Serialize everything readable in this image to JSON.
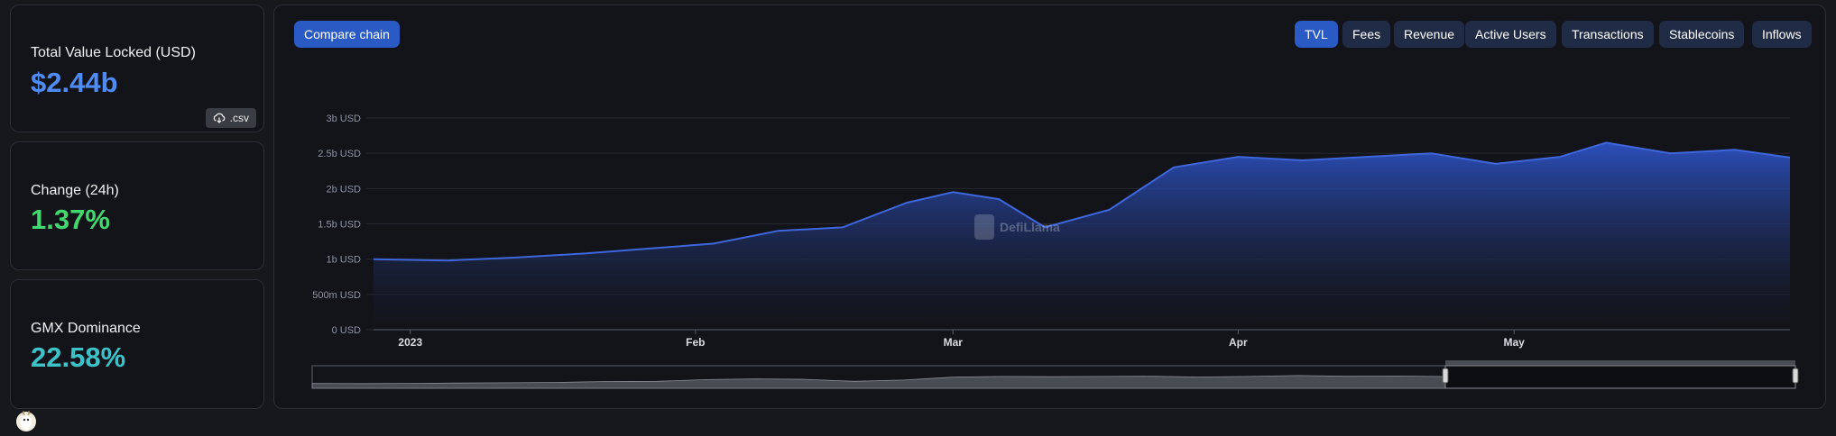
{
  "stats": {
    "tvl": {
      "label": "Total Value Locked (USD)",
      "value": "$2.44b",
      "csv_label": ".csv",
      "color": "#4f8bf4"
    },
    "change": {
      "label": "Change (24h)",
      "value": "1.37%",
      "color": "#42d86f"
    },
    "dominance": {
      "label": "GMX Dominance",
      "value": "22.58%",
      "color": "#3dc2c8"
    }
  },
  "toolbar": {
    "compare_label": "Compare chain",
    "metrics": [
      "TVL",
      "Fees",
      "Revenue",
      "Active Users",
      "Transactions",
      "Stablecoins",
      "Inflows"
    ],
    "active_metric": "TVL"
  },
  "watermark": "DefiLlama",
  "colors": {
    "accent": "#2a5ac3",
    "area_line": "#3f67dd",
    "background": "#131419"
  },
  "chart_data": {
    "type": "area",
    "title": "",
    "xlabel": "",
    "ylabel": "",
    "ylim": [
      0,
      3000000000
    ],
    "y_tick_labels": [
      "0 USD",
      "500m USD",
      "1b USD",
      "1.5b USD",
      "2b USD",
      "2.5b USD",
      "3b USD"
    ],
    "x_tick_labels": [
      "2023",
      "Feb",
      "Mar",
      "Apr",
      "May"
    ],
    "grid": true,
    "series": [
      {
        "values_unit": "USD (billions)",
        "x": [
          "2022-12-28",
          "2023-01-05",
          "2023-01-12",
          "2023-01-20",
          "2023-01-27",
          "2023-02-03",
          "2023-02-10",
          "2023-02-17",
          "2023-02-24",
          "2023-03-01",
          "2023-03-06",
          "2023-03-11",
          "2023-03-18",
          "2023-03-25",
          "2023-04-01",
          "2023-04-08",
          "2023-04-15",
          "2023-04-22",
          "2023-04-29",
          "2023-05-06",
          "2023-05-11",
          "2023-05-18",
          "2023-05-25",
          "2023-05-31"
        ],
        "values": [
          1.0,
          0.98,
          1.02,
          1.08,
          1.15,
          1.22,
          1.4,
          1.45,
          1.8,
          1.95,
          1.85,
          1.45,
          1.7,
          2.3,
          2.45,
          2.4,
          2.45,
          2.5,
          2.35,
          2.45,
          2.65,
          2.5,
          2.55,
          2.44
        ]
      }
    ]
  }
}
